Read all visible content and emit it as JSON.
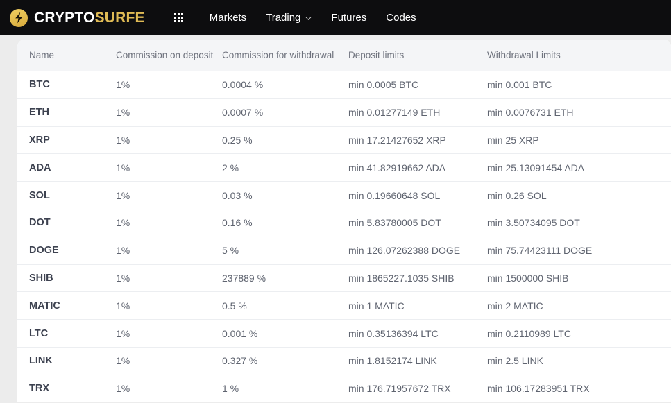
{
  "navbar": {
    "brand": {
      "part1": "CRYPTO",
      "part2": "SURFE",
      "icon": "lightning-bolt-icon"
    },
    "apps_icon": "grid-apps-icon",
    "items": [
      {
        "label": "Markets",
        "has_dropdown": false
      },
      {
        "label": "Trading",
        "has_dropdown": true
      },
      {
        "label": "Futures",
        "has_dropdown": false
      },
      {
        "label": "Codes",
        "has_dropdown": false
      }
    ],
    "background": "#0d0d0f",
    "accent": "#e0bb55"
  },
  "table": {
    "columns": [
      "Name",
      "Commission on deposit",
      "Commission for withdrawal",
      "Deposit limits",
      "Withdrawal Limits"
    ],
    "rows": [
      {
        "name": "BTC",
        "deposit_commission": "1%",
        "withdrawal_commission": "0.0004 %",
        "deposit_limit": "min 0.0005 BTC",
        "withdrawal_limit": "min 0.001 BTC"
      },
      {
        "name": "ETH",
        "deposit_commission": "1%",
        "withdrawal_commission": "0.0007 %",
        "deposit_limit": "min 0.01277149 ETH",
        "withdrawal_limit": "min 0.0076731 ETH"
      },
      {
        "name": "XRP",
        "deposit_commission": "1%",
        "withdrawal_commission": "0.25 %",
        "deposit_limit": "min 17.21427652 XRP",
        "withdrawal_limit": "min 25 XRP"
      },
      {
        "name": "ADA",
        "deposit_commission": "1%",
        "withdrawal_commission": "2 %",
        "deposit_limit": "min 41.82919662 ADA",
        "withdrawal_limit": "min 25.13091454 ADA"
      },
      {
        "name": "SOL",
        "deposit_commission": "1%",
        "withdrawal_commission": "0.03 %",
        "deposit_limit": "min 0.19660648 SOL",
        "withdrawal_limit": "min 0.26 SOL"
      },
      {
        "name": "DOT",
        "deposit_commission": "1%",
        "withdrawal_commission": "0.16 %",
        "deposit_limit": "min 5.83780005 DOT",
        "withdrawal_limit": "min 3.50734095 DOT"
      },
      {
        "name": "DOGE",
        "deposit_commission": "1%",
        "withdrawal_commission": "5 %",
        "deposit_limit": "min 126.07262388 DOGE",
        "withdrawal_limit": "min 75.74423111 DOGE"
      },
      {
        "name": "SHIB",
        "deposit_commission": "1%",
        "withdrawal_commission": "237889 %",
        "deposit_limit": "min 1865227.1035 SHIB",
        "withdrawal_limit": "min 1500000 SHIB"
      },
      {
        "name": "MATIC",
        "deposit_commission": "1%",
        "withdrawal_commission": "0.5 %",
        "deposit_limit": "min 1 MATIC",
        "withdrawal_limit": "min 2 MATIC"
      },
      {
        "name": "LTC",
        "deposit_commission": "1%",
        "withdrawal_commission": "0.001 %",
        "deposit_limit": "min 0.35136394 LTC",
        "withdrawal_limit": "min 0.2110989 LTC"
      },
      {
        "name": "LINK",
        "deposit_commission": "1%",
        "withdrawal_commission": "0.327 %",
        "deposit_limit": "min 1.8152174 LINK",
        "withdrawal_limit": "min 2.5 LINK"
      },
      {
        "name": "TRX",
        "deposit_commission": "1%",
        "withdrawal_commission": "1 %",
        "deposit_limit": "min 176.71957672 TRX",
        "withdrawal_limit": "min 106.17283951 TRX"
      }
    ]
  }
}
